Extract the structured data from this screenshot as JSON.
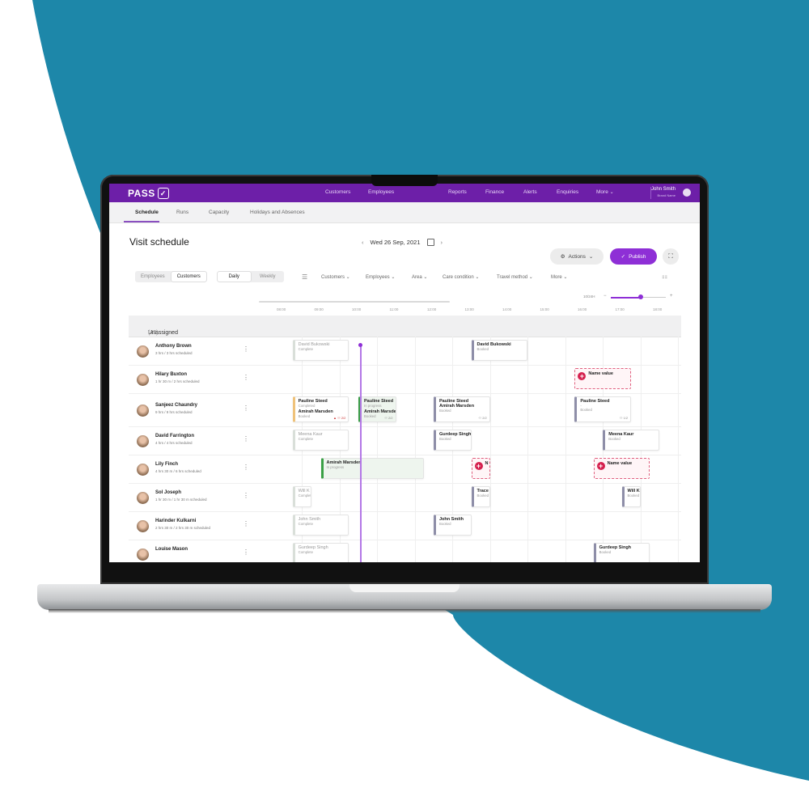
{
  "colors": {
    "background_blue": "#1d87a9",
    "brand_purple": "#6d1fa8",
    "accent_purple": "#8e2fd6",
    "unfilled_red": "#d5214f",
    "in_progress_green": "#3aa046",
    "booked_slate": "#8e8ea8",
    "warn_amber": "#efc27a"
  },
  "topnav": {
    "logo": "PASS",
    "logo_icon": "check-icon",
    "items": [
      "Customers",
      "Employees",
      "Reports",
      "Finance",
      "Alerts",
      "Enquiries",
      "More"
    ],
    "user_name": "John Smith",
    "user_role": "Brand Name"
  },
  "subnav": {
    "tabs": [
      "Schedule",
      "Runs",
      "Capacity",
      "Holidays and Absences"
    ],
    "active": "Schedule"
  },
  "page": {
    "title": "Visit schedule",
    "date": "Wed 26 Sep, 2021",
    "actions_label": "Actions",
    "publish_label": "Publish"
  },
  "toolbar": {
    "view_toggle": [
      "Employees",
      "Customers"
    ],
    "view_selected": "Customers",
    "period_toggle": [
      "Daily",
      "Weekly"
    ],
    "period_selected": "Daily",
    "filters": [
      "Customers",
      "Employees",
      "Area",
      "Care condition",
      "Travel method",
      "More"
    ],
    "zoom_label": "10/24H",
    "zoom_level": 0.55
  },
  "timeline": {
    "hours": [
      "08:00",
      "09:00",
      "10:00",
      "11:00",
      "12:00",
      "13:00",
      "14:00",
      "15:00",
      "16:00",
      "17:00",
      "18:00"
    ],
    "current_time": "10:03"
  },
  "unassigned": {
    "label": "Unassigned",
    "count": "(43)"
  },
  "rows": [
    {
      "name": "Anthony Brown",
      "sub": "3 hrs / 3 hrs scheduled"
    },
    {
      "name": "Hilary Buxton",
      "sub": "1 hr 30 m / 2 hrs scheduled"
    },
    {
      "name": "Sanjeez Chaundry",
      "sub": "9 hrs / 9 hrs scheduled"
    },
    {
      "name": "David Farrington",
      "sub": "4 hrs / 4 hrs scheduled"
    },
    {
      "name": "Lily Finch",
      "sub": "4 hrs 30 m / 6 hrs scheduled"
    },
    {
      "name": "Sol Joseph",
      "sub": "1 hr 30 m / 1 hr 30 m scheduled"
    },
    {
      "name": "Harinder Kulkarni",
      "sub": "2 hrs 30 m / 2 hrs 30 m scheduled"
    },
    {
      "name": "Louise Mason",
      "sub": ""
    }
  ],
  "visits": [
    {
      "row": 0,
      "names": [
        "David Bukowski"
      ],
      "status": "Complete",
      "type": "completed",
      "start": "08:15",
      "end": "09:45"
    },
    {
      "row": 0,
      "names": [
        "David Bukowski"
      ],
      "status": "Booked",
      "type": "booked",
      "start": "13:00",
      "end": "14:30"
    },
    {
      "row": 1,
      "unfilled": true,
      "label": "Name value",
      "start": "15:45",
      "end": "17:15"
    },
    {
      "row": 2,
      "names": [
        "Pauline Steed",
        "Amirah Marsden"
      ],
      "status": "Completed",
      "status2": "Booked",
      "meta": "2/2",
      "warn": true,
      "type": "warn",
      "start": "08:15",
      "end": "09:45"
    },
    {
      "row": 2,
      "names": [
        "Pauline Steed",
        "Amirah Marsden"
      ],
      "status": "In progress",
      "status2": "Booked",
      "meta": "2/2",
      "type": "progress",
      "start": "10:00",
      "end": "11:00"
    },
    {
      "row": 2,
      "names": [
        "Pauline Steed",
        "Amirah Marsden"
      ],
      "status": "Booked",
      "meta": "2/2",
      "type": "booked",
      "start": "12:00",
      "end": "13:30"
    },
    {
      "row": 2,
      "names": [
        "Pauline Steed"
      ],
      "status": "Booked",
      "sub": "-",
      "meta": "1/2",
      "type": "booked",
      "start": "15:45",
      "end": "17:15"
    },
    {
      "row": 3,
      "names": [
        "Meena Kaur"
      ],
      "status": "Complete",
      "type": "completed",
      "start": "08:15",
      "end": "09:45"
    },
    {
      "row": 3,
      "names": [
        "Gurdeep Singh"
      ],
      "status": "Booked",
      "type": "booked",
      "start": "12:00",
      "end": "13:00"
    },
    {
      "row": 3,
      "names": [
        "Meena Kaur"
      ],
      "status": "Booked",
      "type": "booked",
      "start": "16:30",
      "end": "18:00"
    },
    {
      "row": 4,
      "names": [
        "Amirah Marsden"
      ],
      "status": "In progress",
      "type": "progress",
      "start": "09:00",
      "end": "11:45"
    },
    {
      "row": 4,
      "unfilled": true,
      "label": "N",
      "start": "13:00",
      "end": "13:30"
    },
    {
      "row": 4,
      "unfilled": true,
      "label": "Name value",
      "start": "16:15",
      "end": "17:45"
    },
    {
      "row": 5,
      "names": [
        "Will K"
      ],
      "status": "Complete",
      "type": "completed",
      "start": "08:15",
      "end": "08:45"
    },
    {
      "row": 5,
      "names": [
        "Trace"
      ],
      "status": "Booked",
      "type": "booked",
      "start": "13:00",
      "end": "13:30"
    },
    {
      "row": 5,
      "names": [
        "Will Ki"
      ],
      "status": "Booked",
      "type": "booked",
      "start": "17:00",
      "end": "17:30"
    },
    {
      "row": 6,
      "names": [
        "John Smith"
      ],
      "status": "Complete",
      "type": "completed",
      "start": "08:15",
      "end": "09:45"
    },
    {
      "row": 6,
      "names": [
        "John Smith"
      ],
      "status": "Booked",
      "type": "booked",
      "start": "12:00",
      "end": "13:00"
    },
    {
      "row": 7,
      "names": [
        "Gurdeep Singh"
      ],
      "status": "Complete",
      "type": "completed",
      "start": "08:15",
      "end": "09:45"
    },
    {
      "row": 7,
      "names": [
        "Gurdeep Singh"
      ],
      "status": "Booked",
      "type": "booked",
      "start": "16:15",
      "end": "17:45"
    }
  ]
}
